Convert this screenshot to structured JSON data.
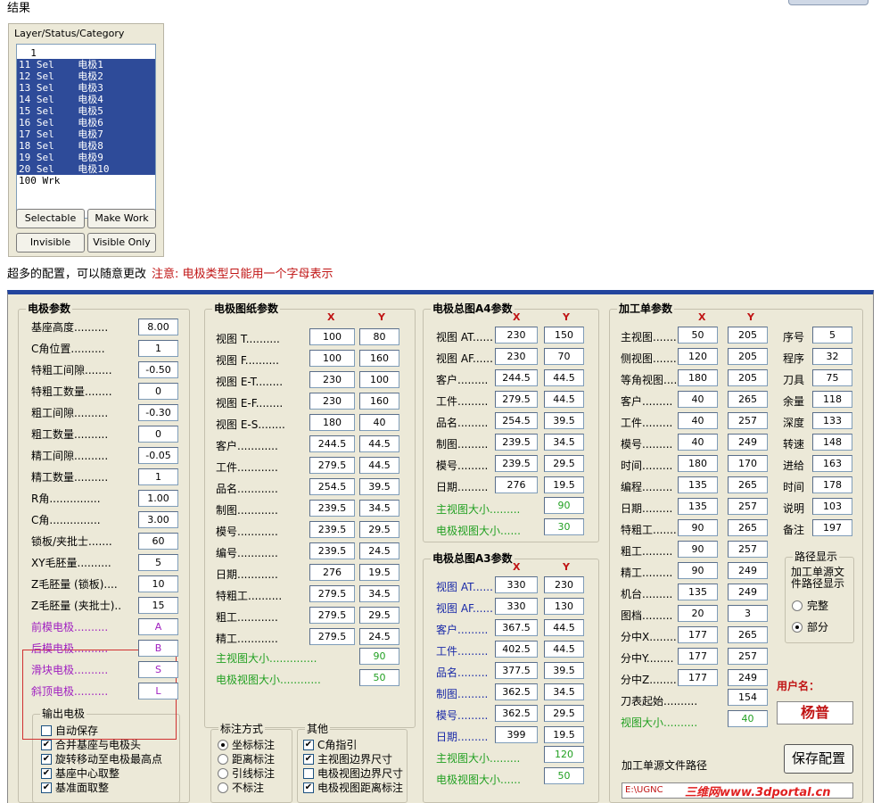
{
  "header": {
    "title": "结果"
  },
  "layer_dialog": {
    "caption": "Layer/Status/Category",
    "rows": [
      {
        "text": "  1",
        "selected": false
      },
      {
        "text": "11 Sel    电极1",
        "selected": true
      },
      {
        "text": "12 Sel    电极2",
        "selected": true
      },
      {
        "text": "13 Sel    电极3",
        "selected": true
      },
      {
        "text": "14 Sel    电极4",
        "selected": true
      },
      {
        "text": "15 Sel    电极5",
        "selected": true
      },
      {
        "text": "16 Sel    电极6",
        "selected": true
      },
      {
        "text": "17 Sel    电极7",
        "selected": true
      },
      {
        "text": "18 Sel    电极8",
        "selected": true
      },
      {
        "text": "19 Sel    电极9",
        "selected": true
      },
      {
        "text": "20 Sel    电极10",
        "selected": true
      },
      {
        "text": "100 Wrk",
        "selected": false
      }
    ],
    "buttons": {
      "selectable": "Selectable",
      "make_work": "Make Work",
      "invisible": "Invisible",
      "visible_only": "Visible Only"
    }
  },
  "note": {
    "text": "超多的配置，可以随意更改",
    "warning": "注意: 电极类型只能用一个字母表示"
  },
  "electrode_params": {
    "title": "电极参数",
    "rows": [
      {
        "label": "基座高度..........",
        "value": "8.00",
        "color": "black"
      },
      {
        "label": "C角位置..........",
        "value": "1",
        "color": "black"
      },
      {
        "label": "特粗工间隙........",
        "value": "-0.50",
        "color": "black"
      },
      {
        "label": "特粗工数量........",
        "value": "0",
        "color": "black"
      },
      {
        "label": "粗工间隙..........",
        "value": "-0.30",
        "color": "black"
      },
      {
        "label": "粗工数量..........",
        "value": "0",
        "color": "black"
      },
      {
        "label": "精工间隙..........",
        "value": "-0.05",
        "color": "black"
      },
      {
        "label": "精工数量..........",
        "value": "1",
        "color": "black"
      },
      {
        "label": "R角...............",
        "value": "1.00",
        "color": "black"
      },
      {
        "label": "C角...............",
        "value": "3.00",
        "color": "black"
      },
      {
        "label": "锁板/夹批士.......",
        "value": "60",
        "color": "black"
      },
      {
        "label": "XY毛胚量..........",
        "value": "5",
        "color": "black"
      },
      {
        "label": "Z毛胚量 (锁板)....",
        "value": "10",
        "color": "black"
      },
      {
        "label": "Z毛胚量 (夹批士)..",
        "value": "15",
        "color": "black"
      },
      {
        "label": "前模电极..........",
        "value": "A",
        "color": "purple"
      },
      {
        "label": "后模电极..........",
        "value": "B",
        "color": "purple"
      },
      {
        "label": "滑块电极..........",
        "value": "S",
        "color": "purple"
      },
      {
        "label": "斜顶电极..........",
        "value": "L",
        "color": "purple"
      }
    ],
    "output_group": {
      "title": "输出电极",
      "items": [
        {
          "label": "自动保存",
          "checked": false
        },
        {
          "label": "合并基座与电极头",
          "checked": true
        },
        {
          "label": "旋转移动至电极最高点",
          "checked": true
        },
        {
          "label": "基座中心取整",
          "checked": true
        },
        {
          "label": "基准面取整",
          "checked": true
        }
      ]
    }
  },
  "drawing_params": {
    "title": "电极图纸参数",
    "col_x": "X",
    "col_y": "Y",
    "rows": [
      {
        "label": "视图 T..........",
        "x": "100",
        "y": "80"
      },
      {
        "label": "视图 F..........",
        "x": "100",
        "y": "160"
      },
      {
        "label": "视图 E-T........",
        "x": "230",
        "y": "100"
      },
      {
        "label": "视图 E-F........",
        "x": "230",
        "y": "160"
      },
      {
        "label": "视图 E-S........",
        "x": "180",
        "y": "40"
      },
      {
        "label": "客户............",
        "x": "244.5",
        "y": "44.5"
      },
      {
        "label": "工件............",
        "x": "279.5",
        "y": "44.5"
      },
      {
        "label": "品名............",
        "x": "254.5",
        "y": "39.5"
      },
      {
        "label": "制图............",
        "x": "239.5",
        "y": "34.5"
      },
      {
        "label": "模号............",
        "x": "239.5",
        "y": "29.5"
      },
      {
        "label": "编号............",
        "x": "239.5",
        "y": "24.5"
      },
      {
        "label": "日期............",
        "x": "276",
        "y": "19.5"
      },
      {
        "label": "特粗工..........",
        "x": "279.5",
        "y": "34.5"
      },
      {
        "label": "粗工............",
        "x": "279.5",
        "y": "29.5"
      },
      {
        "label": "精工............",
        "x": "279.5",
        "y": "24.5"
      }
    ],
    "main_view_size": {
      "label": "主视图大小..............",
      "value": "90"
    },
    "electrode_view_size": {
      "label": "电极视图大小............",
      "value": "50"
    }
  },
  "annotation_group": {
    "title": "标注方式",
    "options": [
      {
        "label": "坐标标注",
        "selected": true
      },
      {
        "label": "距离标注",
        "selected": false
      },
      {
        "label": "引线标注",
        "selected": false
      },
      {
        "label": "不标注",
        "selected": false
      }
    ]
  },
  "other_group": {
    "title": "其他",
    "items": [
      {
        "label": "C角指引",
        "checked": true
      },
      {
        "label": "主视图边界尺寸",
        "checked": true
      },
      {
        "label": "电极视图边界尺寸",
        "checked": false
      },
      {
        "label": "电极视图距离标注",
        "checked": true
      }
    ]
  },
  "a4_params": {
    "title": "电极总图A4参数",
    "col_x": "X",
    "col_y": "Y",
    "rows": [
      {
        "label": "视图 AT......",
        "x": "230",
        "y": "150"
      },
      {
        "label": "视图 AF......",
        "x": "230",
        "y": "70"
      },
      {
        "label": "客户.........",
        "x": "244.5",
        "y": "44.5"
      },
      {
        "label": "工件.........",
        "x": "279.5",
        "y": "44.5"
      },
      {
        "label": "品名.........",
        "x": "254.5",
        "y": "39.5"
      },
      {
        "label": "制图.........",
        "x": "239.5",
        "y": "34.5"
      },
      {
        "label": "模号.........",
        "x": "239.5",
        "y": "29.5"
      },
      {
        "label": "日期.........",
        "x": "276",
        "y": "19.5"
      }
    ],
    "main_view_size": {
      "label": "主视图大小.........",
      "value": "90"
    },
    "electrode_view_size": {
      "label": "电极视图大小......",
      "value": "30"
    }
  },
  "a3_params": {
    "title": "电极总图A3参数",
    "col_x": "X",
    "col_y": "Y",
    "rows": [
      {
        "label": "视图 AT......",
        "x": "330",
        "y": "230"
      },
      {
        "label": "视图 AF......",
        "x": "330",
        "y": "130"
      },
      {
        "label": "客户.........",
        "x": "367.5",
        "y": "44.5"
      },
      {
        "label": "工件.........",
        "x": "402.5",
        "y": "44.5"
      },
      {
        "label": "品名.........",
        "x": "377.5",
        "y": "39.5"
      },
      {
        "label": "制图.........",
        "x": "362.5",
        "y": "34.5"
      },
      {
        "label": "模号.........",
        "x": "362.5",
        "y": "29.5"
      },
      {
        "label": "日期.........",
        "x": "399",
        "y": "19.5"
      }
    ],
    "main_view_size": {
      "label": "主视图大小.........",
      "value": "120"
    },
    "electrode_view_size": {
      "label": "电极视图大小......",
      "value": "50"
    }
  },
  "process_params": {
    "title": "加工单参数",
    "col_x": "X",
    "col_y": "Y",
    "rows": [
      {
        "label": "主视图.......",
        "x": "50",
        "y": "205"
      },
      {
        "label": "侧视图.......",
        "x": "120",
        "y": "205"
      },
      {
        "label": "等角视图.....",
        "x": "180",
        "y": "205"
      },
      {
        "label": "客户.........",
        "x": "40",
        "y": "265"
      },
      {
        "label": "工件.........",
        "x": "40",
        "y": "257"
      },
      {
        "label": "模号.........",
        "x": "40",
        "y": "249"
      },
      {
        "label": "时间.........",
        "x": "180",
        "y": "170"
      },
      {
        "label": "编程.........",
        "x": "135",
        "y": "265"
      },
      {
        "label": "日期.........",
        "x": "135",
        "y": "257"
      },
      {
        "label": "特粗工.......",
        "x": "90",
        "y": "265"
      },
      {
        "label": "粗工.........",
        "x": "90",
        "y": "257"
      },
      {
        "label": "精工.........",
        "x": "90",
        "y": "249"
      },
      {
        "label": "机台.........",
        "x": "135",
        "y": "249"
      },
      {
        "label": "图档.........",
        "x": "20",
        "y": "3"
      },
      {
        "label": "分中X........",
        "x": "177",
        "y": "265"
      },
      {
        "label": "分中Y........",
        "x": "177",
        "y": "257"
      },
      {
        "label": "分中Z........",
        "x": "177",
        "y": "249"
      }
    ],
    "side_rows": [
      {
        "label": "序号",
        "value": "5"
      },
      {
        "label": "程序",
        "value": "32"
      },
      {
        "label": "刀具",
        "value": "75"
      },
      {
        "label": "余量",
        "value": "118"
      },
      {
        "label": "深度",
        "value": "133"
      },
      {
        "label": "转速",
        "value": "148"
      },
      {
        "label": "进给",
        "value": "163"
      },
      {
        "label": "时间",
        "value": "178"
      },
      {
        "label": "说明",
        "value": "103"
      },
      {
        "label": "备注",
        "value": "197"
      }
    ],
    "tool_start": {
      "label": "刀表起始..........",
      "value": "154"
    },
    "view_size": {
      "label": "视图大小..........",
      "value": "40"
    },
    "path_group": {
      "title": "路径显示",
      "caption": "加工单源文件路径显示",
      "options": [
        {
          "label": "完整",
          "selected": false
        },
        {
          "label": "部分",
          "selected": true
        }
      ]
    },
    "user": {
      "label": "用户名：",
      "value": "杨普"
    },
    "save_button": "保存配置",
    "source_path_label": "加工单源文件路径",
    "source_path_value": "E:\\UGNC"
  },
  "watermark": "三维网www.3dportal.cn"
}
